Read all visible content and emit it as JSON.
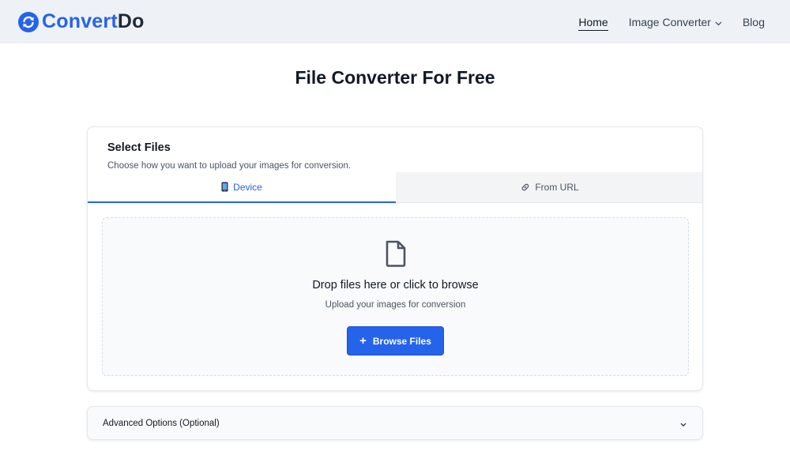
{
  "brand": {
    "part1": "Convert",
    "part2": "Do",
    "icon": "refresh-circle-icon",
    "color": "#2563eb"
  },
  "nav": {
    "home": "Home",
    "image_converter": "Image Converter",
    "blog": "Blog"
  },
  "page": {
    "title": "File Converter For Free"
  },
  "select_files": {
    "title": "Select Files",
    "subtitle": "Choose how you want to upload your images for conversion.",
    "tabs": [
      {
        "label": "Device",
        "icon": "mobile-phone-icon",
        "active": true
      },
      {
        "label": "From URL",
        "icon": "link-icon",
        "active": false
      }
    ]
  },
  "dropzone": {
    "icon": "file-icon",
    "title": "Drop files here or click to browse",
    "subtitle": "Upload your images for conversion",
    "button_label": "Browse Files"
  },
  "advanced": {
    "label": "Advanced Options (Optional)"
  },
  "colors": {
    "accent": "#2563eb",
    "header_bg": "#eef2f6"
  }
}
